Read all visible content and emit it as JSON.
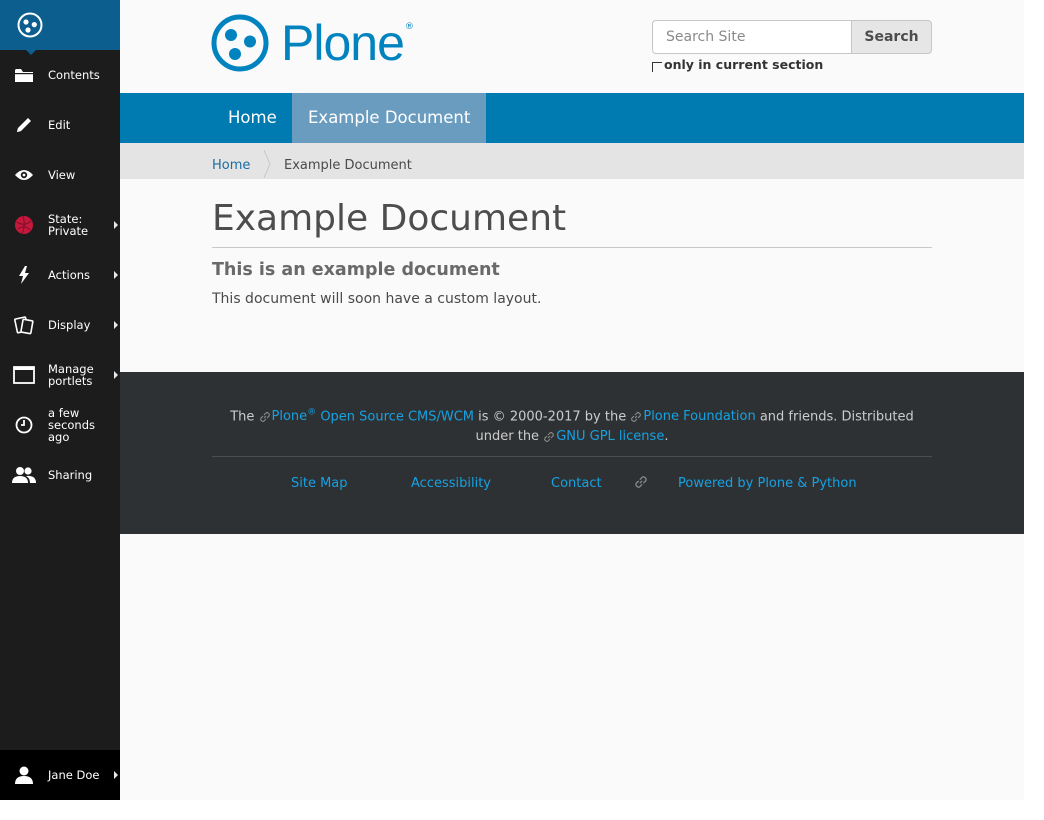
{
  "toolbar": {
    "items": [
      {
        "label": "Contents",
        "icon": "folder-icon"
      },
      {
        "label": "Edit",
        "icon": "pencil-icon"
      },
      {
        "label": "View",
        "icon": "eye-icon"
      },
      {
        "label": "State: Private",
        "icon": "state-icon"
      },
      {
        "label": "Actions",
        "icon": "bolt-icon"
      },
      {
        "label": "Display",
        "icon": "display-icon"
      },
      {
        "label": "Manage portlets",
        "icon": "portlets-icon"
      },
      {
        "label": "a few seconds ago",
        "icon": "clock-icon"
      },
      {
        "label": "Sharing",
        "icon": "users-icon"
      }
    ],
    "user": {
      "label": "Jane Doe",
      "icon": "user-icon"
    }
  },
  "header": {
    "logo_text": "Plone",
    "logo_reg": "®",
    "search": {
      "placeholder": "Search Site",
      "button_label": "Search",
      "checkbox_label": "only in current section"
    }
  },
  "nav": {
    "tabs": [
      {
        "label": "Home"
      },
      {
        "label": "Example Document"
      }
    ]
  },
  "breadcrumbs": {
    "home": "Home",
    "current": "Example Document"
  },
  "content": {
    "title": "Example Document",
    "description": "This is an example document",
    "body": "This document will soon have a custom layout."
  },
  "footer": {
    "colophon": {
      "t1": "The ",
      "plone": "Plone",
      "reg": "®",
      "oss": " Open Source CMS/WCM",
      "t2": " is © 2000-2017 by the ",
      "foundation": "Plone Foundation",
      "t3": " and friends. Distributed under the ",
      "license": "GNU GPL license",
      "t4": "."
    },
    "actions": {
      "sitemap": "Site Map",
      "accessibility": "Accessibility",
      "contact": "Contact",
      "powered": "Powered by Plone & Python"
    }
  },
  "colors": {
    "toolbar_bg": "#1c1c1c",
    "logo_box": "#0b5e8e",
    "nav_bg": "#007bb1",
    "nav_active": "#6a9cbf",
    "footer_bg": "#2e3133",
    "link": "#16a1e3",
    "state_private": "#c4183c"
  }
}
